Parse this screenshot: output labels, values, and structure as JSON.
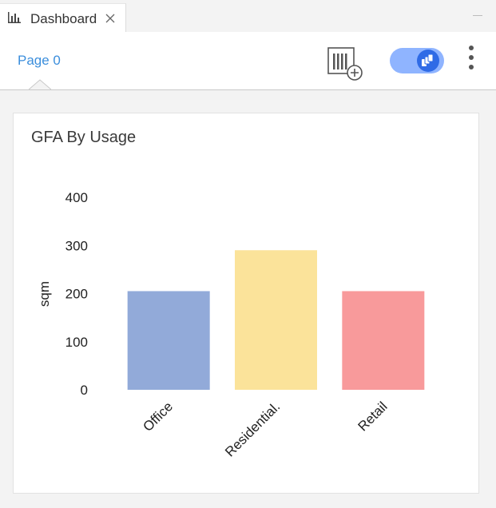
{
  "tab": {
    "title": "Dashboard"
  },
  "toolbar": {
    "page_label": "Page 0"
  },
  "widget": {
    "title": "GFA By Usage"
  },
  "colors": {
    "accent": "#3b8edc",
    "toggle_track": "#8fb4ff",
    "toggle_knob": "#2f6be6"
  },
  "icons": {
    "tab": "bar-chart-icon",
    "close": "close-icon",
    "add_chart": "add-chart-icon",
    "toggle": "toggle-switch",
    "menu": "kebab-menu-icon"
  },
  "chart_data": {
    "type": "bar",
    "categories": [
      "Office",
      "Residential.",
      "Retail"
    ],
    "values": [
      205,
      290,
      205
    ],
    "colors": [
      "#92aad9",
      "#fbe39a",
      "#f89a9b"
    ],
    "xlabel": "",
    "ylabel": "sqm",
    "ylim": [
      0,
      400
    ],
    "yticks": [
      0,
      100,
      200,
      300,
      400
    ],
    "grid": false,
    "legend": "none"
  }
}
